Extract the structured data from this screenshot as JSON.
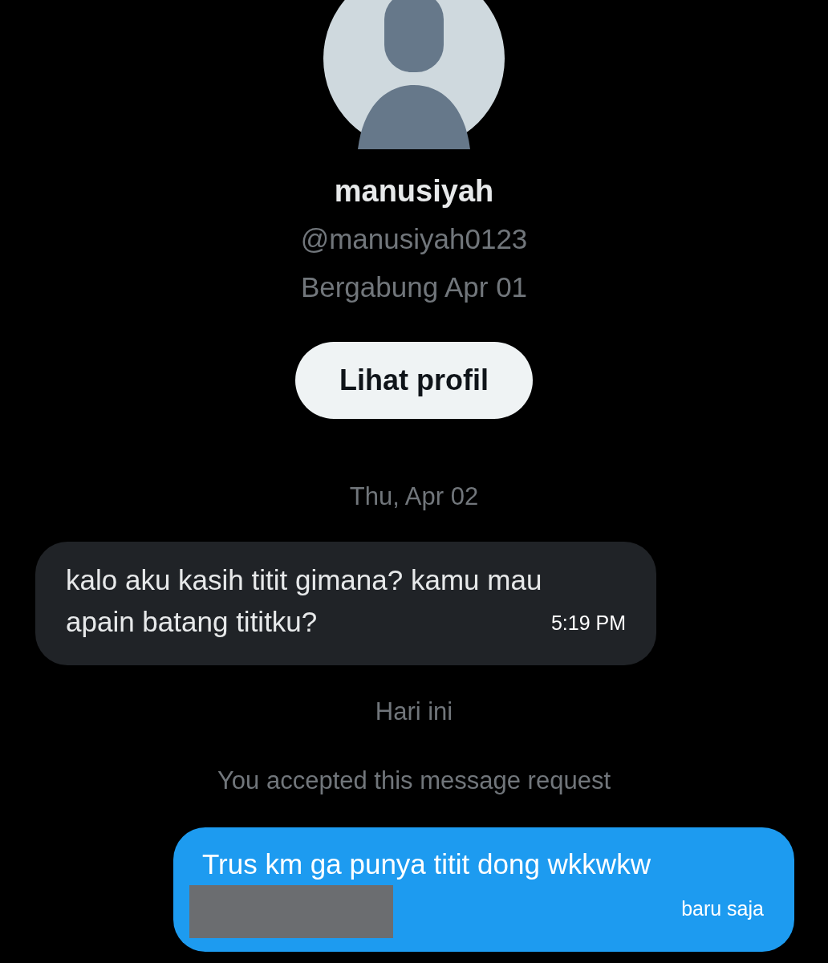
{
  "profile": {
    "name": "manusiyah",
    "handle": "@manusiyah0123",
    "joined": "Bergabung Apr 01",
    "button": "Lihat profil"
  },
  "messages": [
    {
      "kind": "date",
      "text": "Thu, Apr 02"
    },
    {
      "kind": "received",
      "text": "kalo aku kasih titit gimana? kamu mau apain batang tititku?",
      "time": "5:19 PM"
    },
    {
      "kind": "date",
      "text": "Hari ini"
    },
    {
      "kind": "notice",
      "text": "You accepted this message request"
    },
    {
      "kind": "sent",
      "text": "Trus km ga punya titit dong wkkwkw",
      "time": "baru saja",
      "redacted": true
    }
  ]
}
